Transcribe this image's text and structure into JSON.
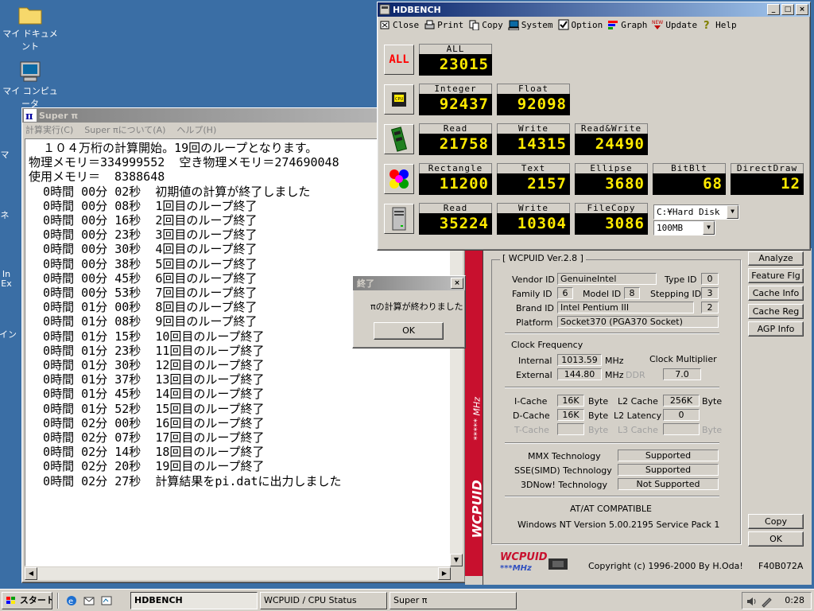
{
  "desktop": {
    "icons": [
      {
        "label": "マイ ドキュメント"
      },
      {
        "label": "マイ コンピュータ"
      }
    ],
    "partial_labels": [
      "マ",
      "ネ",
      "In",
      "Ex",
      "イン"
    ]
  },
  "superpi": {
    "title": "Super π",
    "menu": [
      "計算実行(C)",
      "Super πについて(A)",
      "ヘルプ(H)"
    ],
    "lines": [
      "  １０４万桁の計算開始。19回のループとなります。",
      "物理メモリ＝334999552  空き物理メモリ＝274690048",
      "使用メモリ＝  8388648",
      "  0時間 00分 02秒  初期値の計算が終了しました",
      "  0時間 00分 08秒  1回目のループ終了",
      "  0時間 00分 16秒  2回目のループ終了",
      "  0時間 00分 23秒  3回目のループ終了",
      "  0時間 00分 30秒  4回目のループ終了",
      "  0時間 00分 38秒  5回目のループ終了",
      "  0時間 00分 45秒  6回目のループ終了",
      "  0時間 00分 53秒  7回目のループ終了",
      "  0時間 01分 00秒  8回目のループ終了",
      "  0時間 01分 08秒  9回目のループ終了",
      "  0時間 01分 15秒  10回目のループ終了",
      "  0時間 01分 23秒  11回目のループ終了",
      "  0時間 01分 30秒  12回目のループ終了",
      "  0時間 01分 37秒  13回目のループ終了",
      "  0時間 01分 45秒  14回目のループ終了",
      "  0時間 01分 52秒  15回目のループ終了",
      "  0時間 02分 00秒  16回目のループ終了",
      "  0時間 02分 07秒  17回目のループ終了",
      "  0時間 02分 14秒  18回目のループ終了",
      "  0時間 02分 20秒  19回目のループ終了",
      "  0時間 02分 27秒  計算結果をpi.datに出力しました"
    ]
  },
  "hdbench": {
    "title": "HDBENCH",
    "toolbar": [
      {
        "label": "Close",
        "icon": "close-icon"
      },
      {
        "label": "Print",
        "icon": "printer-icon"
      },
      {
        "label": "Copy",
        "icon": "copy-icon"
      },
      {
        "label": "System",
        "icon": "computer-icon"
      },
      {
        "label": "Option",
        "icon": "checkbox-icon"
      },
      {
        "label": "Graph",
        "icon": "graph-icon"
      },
      {
        "label": "Update",
        "icon": "new-icon"
      },
      {
        "label": "Help",
        "icon": "help-icon"
      }
    ],
    "all_label": "ALL",
    "all": {
      "label": "ALL",
      "value": "23015"
    },
    "cpu": [
      {
        "label": "Integer",
        "value": "92437"
      },
      {
        "label": "Float",
        "value": "92098"
      }
    ],
    "memory": [
      {
        "label": "Read",
        "value": "21758"
      },
      {
        "label": "Write",
        "value": "14315"
      },
      {
        "label": "Read&Write",
        "value": "24490"
      }
    ],
    "video": [
      {
        "label": "Rectangle",
        "value": "11200"
      },
      {
        "label": "Text",
        "value": "2157"
      },
      {
        "label": "Ellipse",
        "value": "3680"
      },
      {
        "label": "BitBlt",
        "value": "68"
      },
      {
        "label": "DirectDraw",
        "value": "12"
      }
    ],
    "disk": [
      {
        "label": "Read",
        "value": "35224"
      },
      {
        "label": "Write",
        "value": "10304"
      },
      {
        "label": "FileCopy",
        "value": "3086"
      }
    ],
    "drive": "C:¥Hard Disk",
    "size": "100MB",
    "colors": {
      "led": "#ffea00",
      "led_bg": "#000000",
      "all_text": "#ff0000"
    }
  },
  "wcpuid": {
    "title": "WCPUID / CPU Status",
    "group_title": "[ WCPUID Ver.2.8 ]",
    "vendor_label": "Vendor ID",
    "vendor": "GenuineIntel",
    "type_label": "Type ID",
    "type": "0",
    "family_label": "Family ID",
    "family": "6",
    "model_label": "Model ID",
    "model": "8",
    "stepping_label": "Stepping ID",
    "stepping": "3",
    "brand_label": "Brand ID",
    "brand": "Intel Pentium III",
    "brand_num": "2",
    "platform_label": "Platform",
    "platform": "Socket370 (PGA370 Socket)",
    "clock_title": "Clock Frequency",
    "internal_label": "Internal",
    "internal": "1013.59",
    "mhz": "MHz",
    "multiplier_label": "Clock Multiplier",
    "external_label": "External",
    "external": "144.80",
    "ddr": "DDR",
    "multiplier": "7.0",
    "icache_label": "I-Cache",
    "icache": "16K",
    "byte": "Byte",
    "l2_label": "L2 Cache",
    "l2": "256K",
    "dcache_label": "D-Cache",
    "dcache": "16K",
    "l2lat_label": "L2 Latency",
    "l2lat": "0",
    "tcache_label": "T-Cache",
    "l3_label": "L3 Cache",
    "mmx_label": "MMX Technology",
    "mmx": "Supported",
    "sse_label": "SSE(SIMD) Technology",
    "sse": "Supported",
    "now_label": "3DNow! Technology",
    "now": "Not Supported",
    "compat": "AT/AT COMPATIBLE",
    "os": "Windows NT  Version 5.00.2195 Service Pack 1",
    "buttons": [
      "Analyze",
      "Feature Flg",
      "Cache Info",
      "Cache Reg",
      "AGP Info"
    ],
    "copy_btn": "Copy",
    "ok_btn": "OK",
    "copyright": "Copyright (c) 1996-2000  By H.Oda!",
    "code": "F40B072A",
    "side_text": "WCPUID",
    "side_text2": "***** MHz",
    "logo": "WCPUID",
    "logo_sub": "***MHz"
  },
  "dialog": {
    "title": "終了",
    "message": "πの計算が終わりました",
    "ok": "OK"
  },
  "taskbar": {
    "start": "スタート",
    "tasks": [
      "HDBENCH",
      "WCPUID / CPU Status",
      "Super π"
    ],
    "time": "0:28"
  }
}
